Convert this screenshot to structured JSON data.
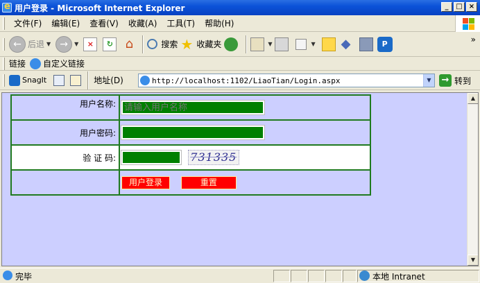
{
  "window": {
    "title": "用户登录 - Microsoft Internet Explorer",
    "controls": [
      "_",
      "□",
      "×"
    ]
  },
  "menu": [
    "文件(F)",
    "编辑(E)",
    "查看(V)",
    "收藏(A)",
    "工具(T)",
    "帮助(H)"
  ],
  "toolbar": {
    "back_label": "后退",
    "search_label": "搜索",
    "favorites_label": "收藏夹",
    "more": "»"
  },
  "links": {
    "label": "链接",
    "custom": "自定义链接"
  },
  "addressbar": {
    "snagit": "SnagIt",
    "label": "地址(D)",
    "url": "http://localhost:1102/LiaoTian/Login.aspx",
    "go_label": "转到"
  },
  "form": {
    "username_label": "用户名称:",
    "username_placeholder": "请输入用户名称",
    "password_label": "用户密码:",
    "captcha_label": "验 证 码:",
    "captcha_text": "731335",
    "login_button": "用户登录",
    "reset_button": "重置"
  },
  "status": {
    "text": "完毕",
    "zone": "本地 Intranet"
  },
  "colors": {
    "page_bg": "#cccfff",
    "border": "#1f7a1f",
    "input_bg": "#008000",
    "button_bg": "#ff0000"
  }
}
